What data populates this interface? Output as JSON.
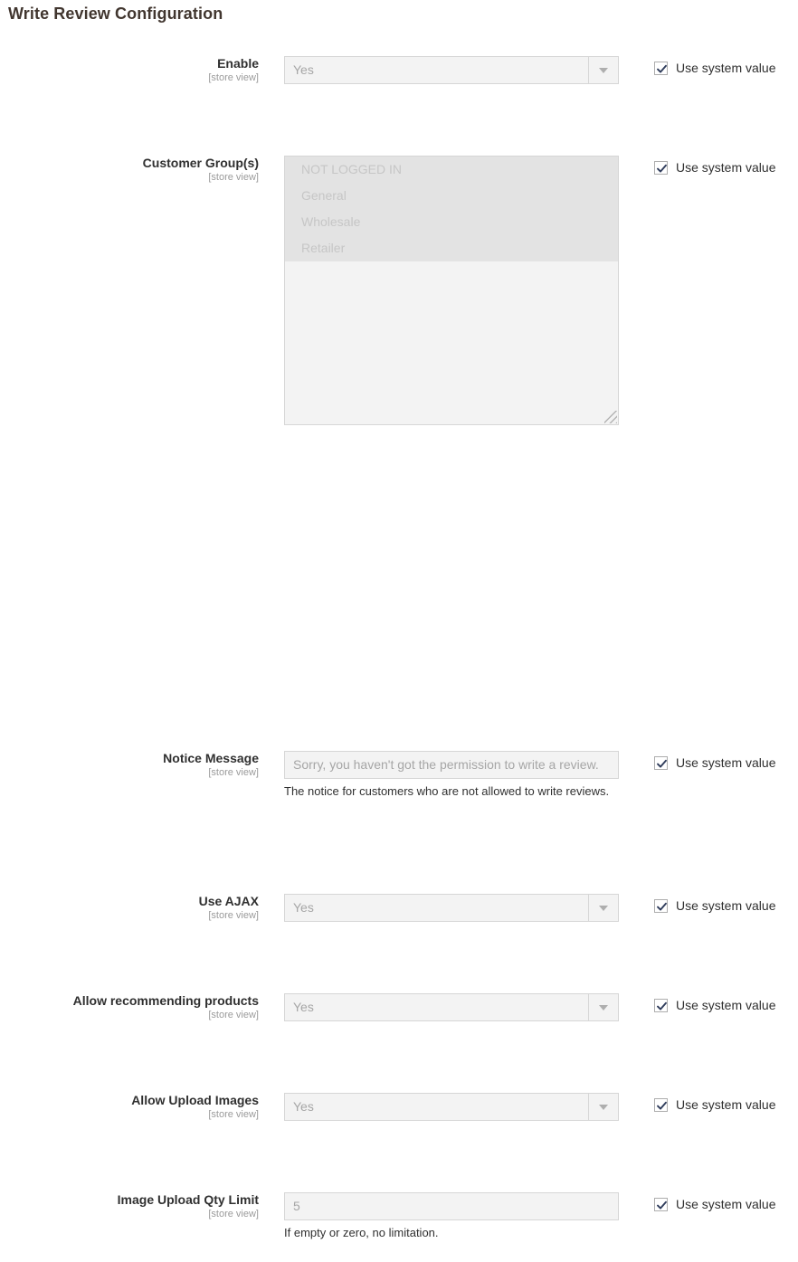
{
  "page": {
    "title": "Write Review Configuration",
    "scope_note": "[store view]",
    "use_system_value_label": "Use system value"
  },
  "fields": [
    {
      "id": "enable",
      "label": "Enable",
      "scope": "[store view]",
      "type": "select",
      "value": "Yes",
      "use_system_value": true,
      "hint": ""
    },
    {
      "id": "customer_groups",
      "label": "Customer Group(s)",
      "scope": "[store view]",
      "type": "multiselect",
      "options": [
        {
          "label": "NOT LOGGED IN",
          "selected": true
        },
        {
          "label": "General",
          "selected": true
        },
        {
          "label": "Wholesale",
          "selected": true
        },
        {
          "label": "Retailer",
          "selected": true
        }
      ],
      "use_system_value": true,
      "hint": ""
    },
    {
      "id": "notice_message",
      "label": "Notice Message",
      "scope": "[store view]",
      "type": "text",
      "value": "Sorry, you haven't got the permission to write a review.",
      "use_system_value": true,
      "hint": "The notice for customers who are not allowed to write reviews."
    },
    {
      "id": "use_ajax",
      "label": "Use AJAX",
      "scope": "[store view]",
      "type": "select",
      "value": "Yes",
      "use_system_value": true,
      "hint": ""
    },
    {
      "id": "allow_recommending_products",
      "label": "Allow recommending products",
      "scope": "[store view]",
      "type": "select",
      "value": "Yes",
      "use_system_value": true,
      "hint": ""
    },
    {
      "id": "allow_upload_images",
      "label": "Allow Upload Images",
      "scope": "[store view]",
      "type": "select",
      "value": "Yes",
      "use_system_value": true,
      "hint": ""
    },
    {
      "id": "image_upload_qty_limit",
      "label": "Image Upload Qty Limit",
      "scope": "[store view]",
      "type": "text",
      "value": "5",
      "use_system_value": true,
      "hint": "If empty or zero, no limitation."
    }
  ],
  "colors": {
    "title": "#41362f",
    "label": "#303030",
    "scope": "#9b9b9b",
    "field_bg": "#f3f3f3",
    "field_border": "#d6d6d6",
    "disabled_text": "#a6a6a6",
    "selected_option_bg": "#e3e3e3",
    "checkbox_border": "#adadad"
  }
}
